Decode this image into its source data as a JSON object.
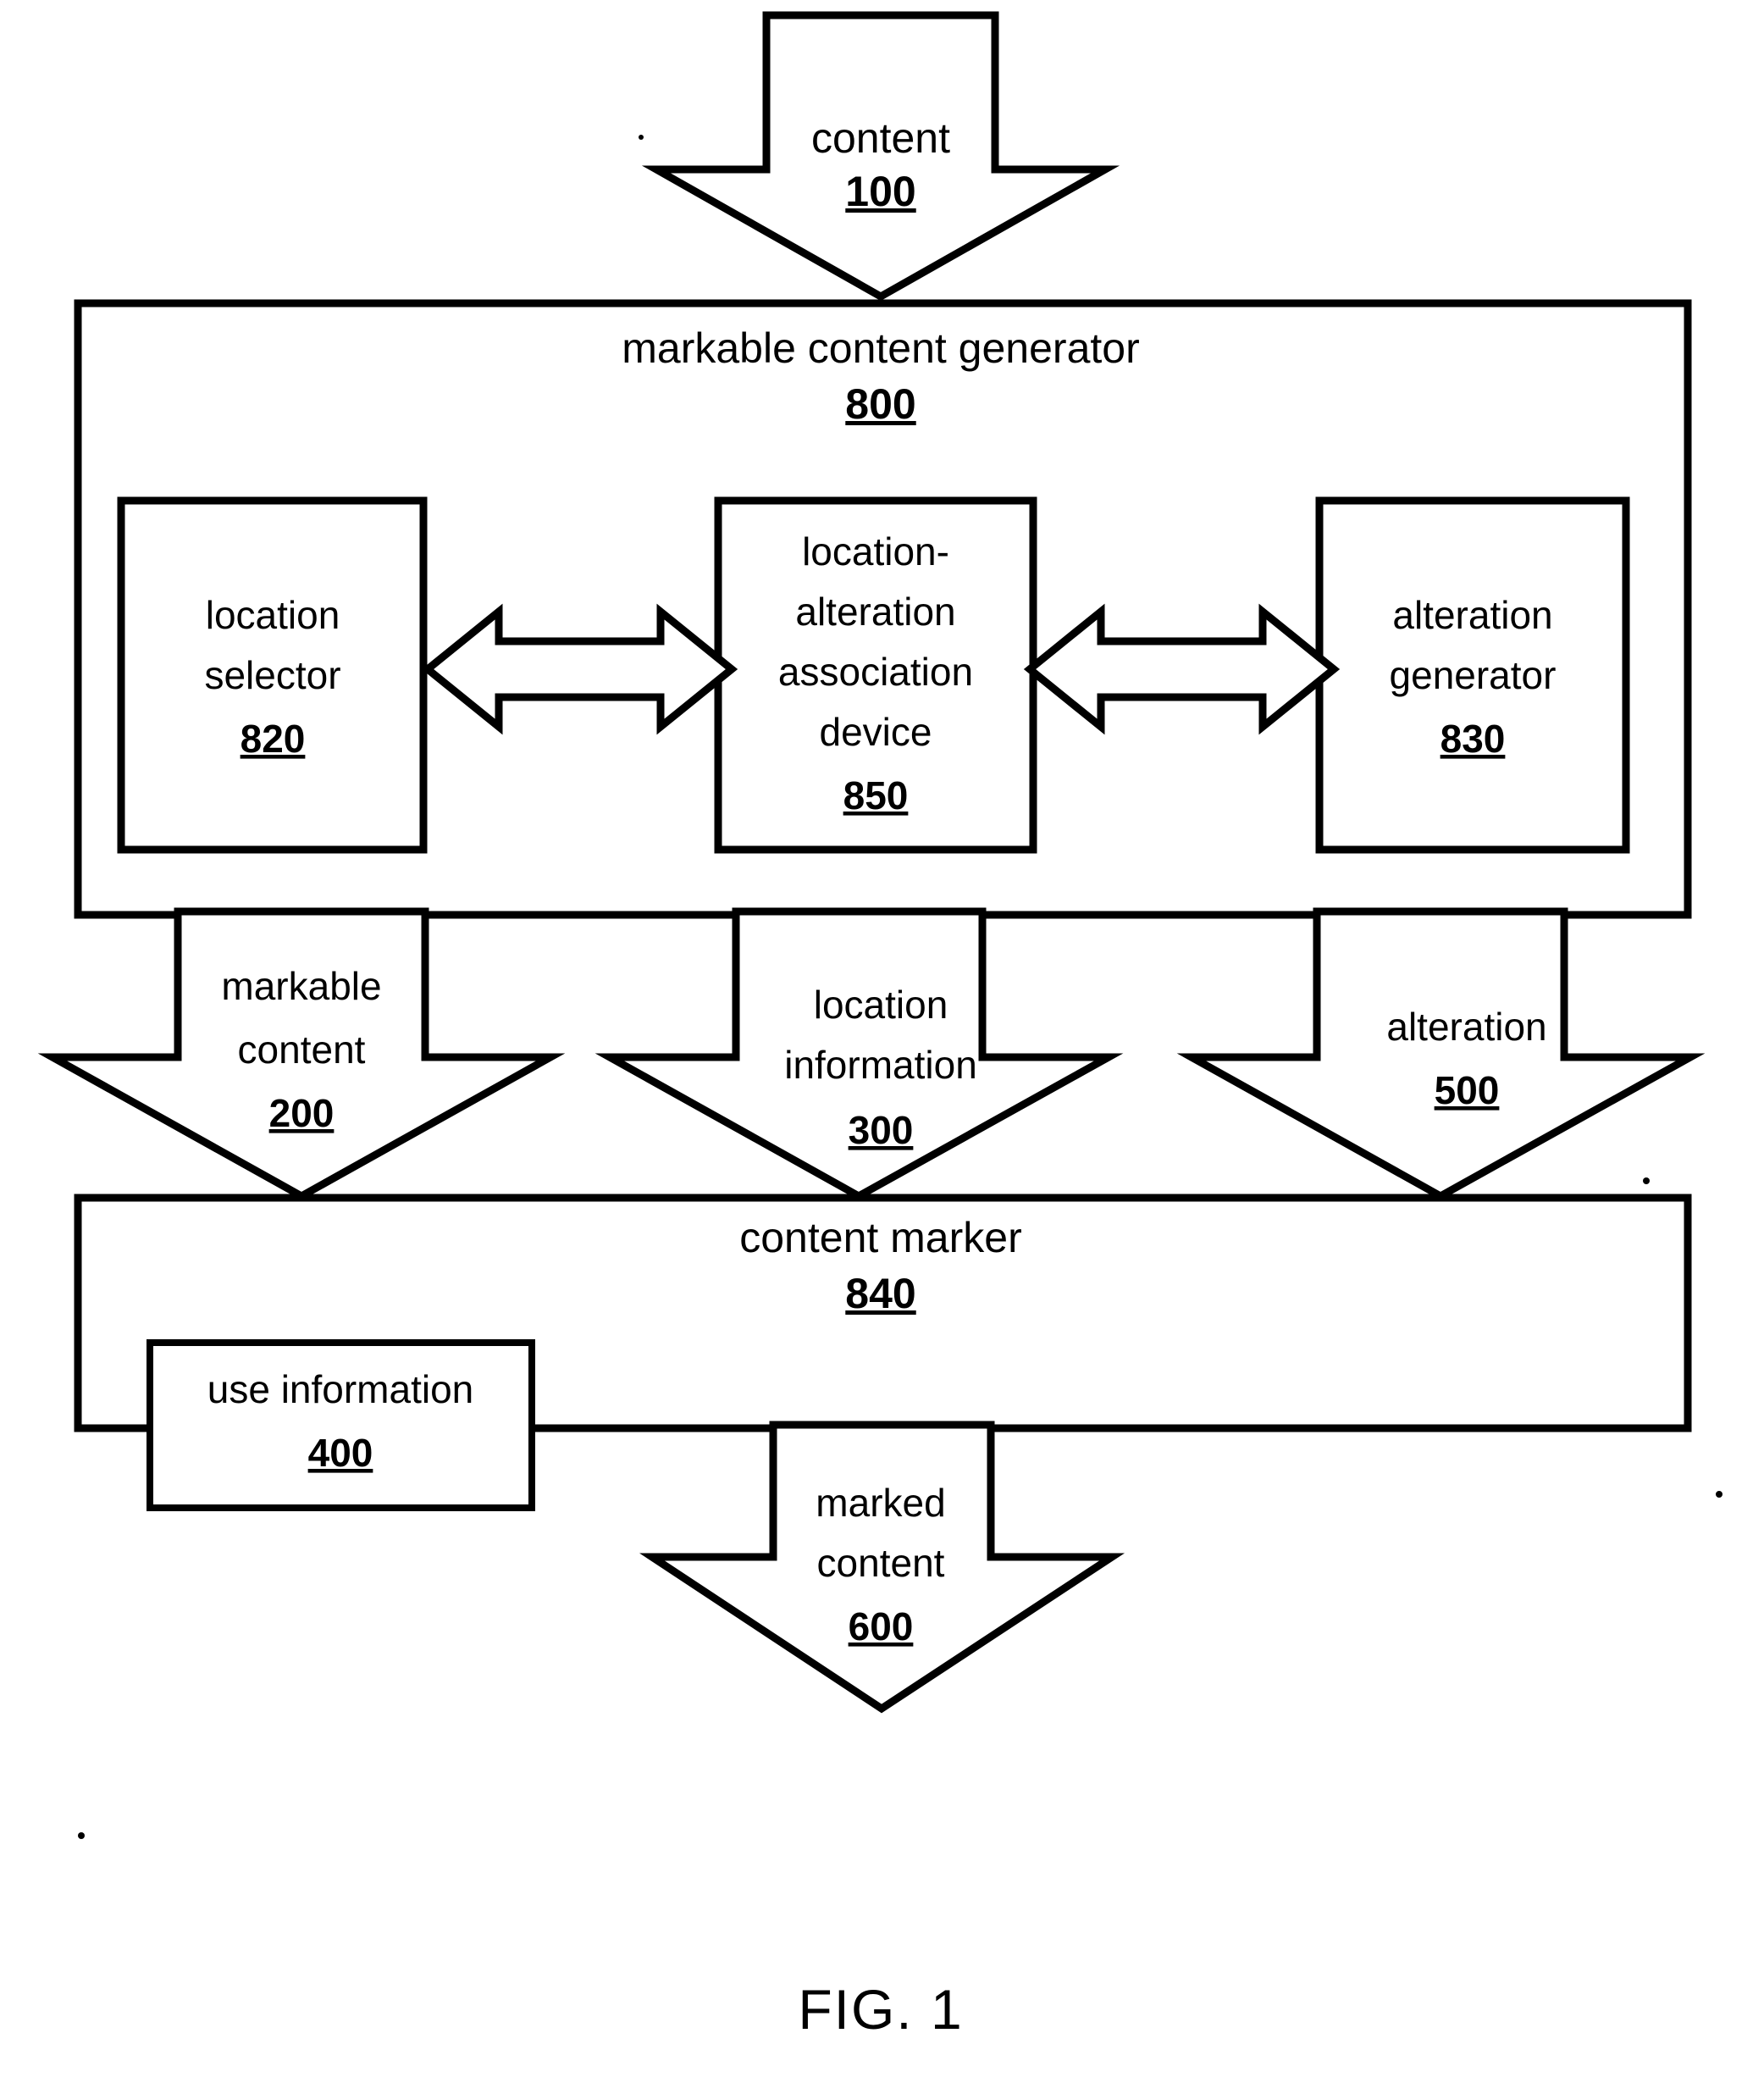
{
  "figure": {
    "caption": "FIG. 1"
  },
  "nodes": {
    "content_in": {
      "label": "content",
      "ref": "100"
    },
    "markable_content_generator": {
      "label": "markable content generator",
      "ref": "800"
    },
    "location_selector": {
      "label_line1": "location",
      "label_line2": "selector",
      "ref": "820"
    },
    "location_alteration_association_device": {
      "label_line1": "location-",
      "label_line2": "alteration",
      "label_line3": "association",
      "label_line4": "device",
      "ref": "850"
    },
    "alteration_generator": {
      "label_line1": "alteration",
      "label_line2": "generator",
      "ref": "830"
    },
    "markable_content_out": {
      "label_line1": "markable",
      "label_line2": "content",
      "ref": "200"
    },
    "location_information_out": {
      "label_line1": "location",
      "label_line2": "information",
      "ref": "300"
    },
    "alteration_out": {
      "label": "alteration",
      "ref": "500"
    },
    "content_marker": {
      "label": "content marker",
      "ref": "840"
    },
    "use_information": {
      "label": "use information",
      "ref": "400"
    },
    "marked_content_out": {
      "label_line1": "marked",
      "label_line2": "content",
      "ref": "600"
    }
  },
  "connectors": {
    "selector_to_association": "bidirectional-block-arrow",
    "association_to_generator": "bidirectional-block-arrow"
  },
  "colors": {
    "ink": "#000000",
    "paper": "#ffffff"
  }
}
